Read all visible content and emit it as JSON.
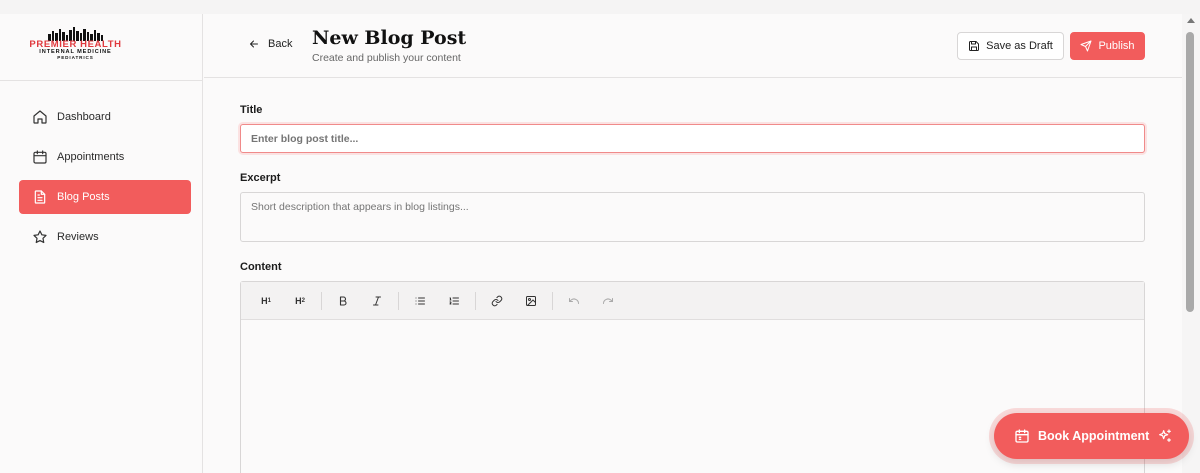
{
  "brand": {
    "line1": "PREMIER HEALTH",
    "line2": "INTERNAL MEDICINE",
    "line3": "PEDIATRICS",
    "accent_color": "#f25c5c"
  },
  "sidebar": {
    "items": [
      {
        "label": "Dashboard",
        "icon": "home-icon",
        "active": false
      },
      {
        "label": "Appointments",
        "icon": "calendar-icon",
        "active": false
      },
      {
        "label": "Blog Posts",
        "icon": "document-icon",
        "active": true
      },
      {
        "label": "Reviews",
        "icon": "star-icon",
        "active": false
      }
    ]
  },
  "header": {
    "back_label": "Back",
    "title": "New Blog Post",
    "subtitle": "Create and publish your content",
    "save_draft_label": "Save as Draft",
    "publish_label": "Publish"
  },
  "form": {
    "title_label": "Title",
    "title_placeholder": "Enter blog post title...",
    "title_value": "",
    "excerpt_label": "Excerpt",
    "excerpt_placeholder": "Short description that appears in blog listings...",
    "excerpt_value": "",
    "content_label": "Content"
  },
  "toolbar": {
    "h1": "H",
    "h1_sub": "1",
    "h2": "H",
    "h2_sub": "2",
    "buttons": [
      "heading-1",
      "heading-2",
      "bold",
      "italic",
      "bullet-list",
      "numbered-list",
      "link",
      "image",
      "undo",
      "redo"
    ]
  },
  "fab": {
    "label": "Book Appointment"
  }
}
